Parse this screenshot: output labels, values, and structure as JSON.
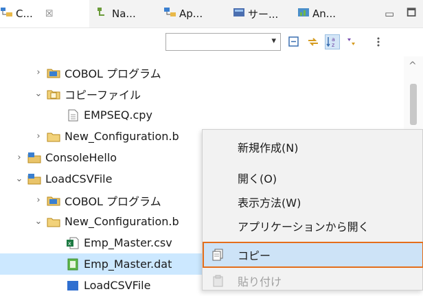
{
  "tabs": [
    {
      "label": "C...",
      "icon": "project-explorer-icon"
    },
    {
      "label": "Na...",
      "icon": "navigator-icon"
    },
    {
      "label": "Ap...",
      "icon": "application-explorer-icon"
    },
    {
      "label": "サー...",
      "icon": "server-icon"
    },
    {
      "label": "An...",
      "icon": "analyzer-icon"
    }
  ],
  "tab_close_glyph": "☒",
  "window": {
    "minimize": "▭",
    "maximize": "🗖"
  },
  "toolbar": {
    "combo_value": "",
    "combo_arrow": "▾"
  },
  "tree": [
    {
      "label": "COBOL プログラム",
      "icon": "cobol-folder-icon",
      "twisty": "›"
    },
    {
      "label": "コピーファイル",
      "icon": "copyfile-folder-icon",
      "twisty": "⌄"
    },
    {
      "label": "EMPSEQ.cpy",
      "icon": "file-icon",
      "twisty": ""
    },
    {
      "label": "New_Configuration.b",
      "icon": "folder-icon",
      "twisty": "›"
    },
    {
      "label": "ConsoleHello",
      "icon": "project-icon",
      "twisty": "›"
    },
    {
      "label": "LoadCSVFile",
      "icon": "project-icon",
      "twisty": "⌄"
    },
    {
      "label": "COBOL プログラム",
      "icon": "cobol-folder-icon",
      "twisty": "›"
    },
    {
      "label": "New_Configuration.b",
      "icon": "folder-icon",
      "twisty": "⌄"
    },
    {
      "label": "Emp_Master.csv",
      "icon": "csv-file-icon",
      "twisty": ""
    },
    {
      "label": "Emp_Master.dat",
      "icon": "dat-file-icon",
      "twisty": ""
    },
    {
      "label": "LoadCSVFile",
      "icon": "file-icon",
      "twisty": ""
    }
  ],
  "context_menu": {
    "items": [
      {
        "label": "新規作成(N)"
      },
      {
        "label": "開く(O)"
      },
      {
        "label": "表示方法(W)"
      },
      {
        "label": "アプリケーションから開く"
      },
      {
        "label": "コピー"
      },
      {
        "label": "貼り付け"
      }
    ]
  },
  "colors": {
    "highlight_border": "#e46e1a",
    "highlight_fill": "#cde3f7",
    "selection": "#cce8ff"
  }
}
